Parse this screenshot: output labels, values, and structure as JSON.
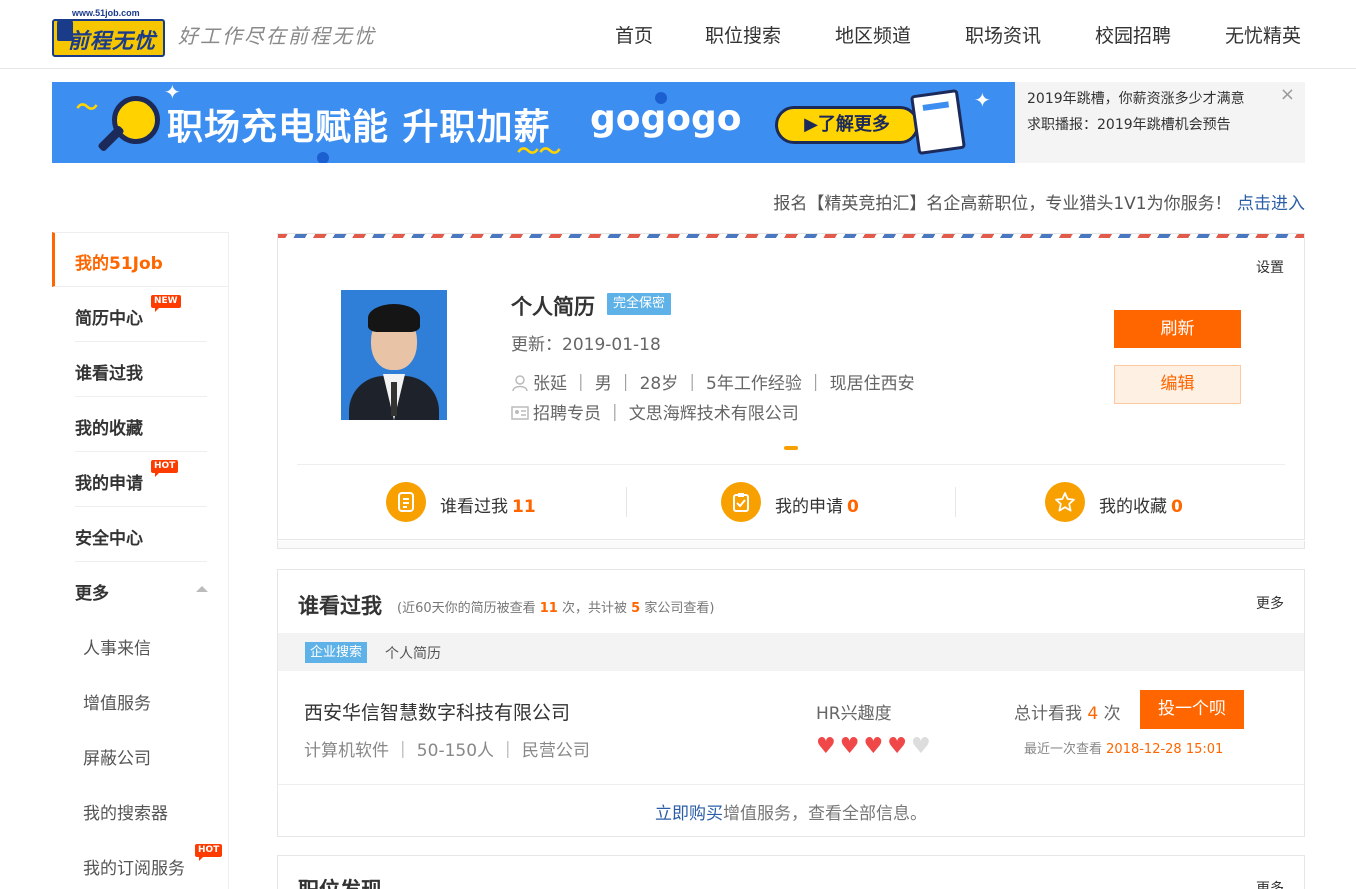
{
  "header": {
    "logo_url": "www.51job.com",
    "logo_text": "前程无忧",
    "slogan": "好工作尽在前程无忧",
    "nav": [
      "首页",
      "职位搜索",
      "地区频道",
      "职场资讯",
      "校园招聘",
      "无忧精英"
    ]
  },
  "banner": {
    "title": "职场充电赋能  升职加薪",
    "go": "gogogo",
    "button": "▶了解更多"
  },
  "side_news": {
    "items": [
      "2019年跳槽，你薪资涨多少才满意",
      "求职播报：2019年跳槽机会预告"
    ],
    "close": "×"
  },
  "promo": {
    "text": "报名【精英竞拍汇】名企高薪职位，专业猎头1V1为你服务！",
    "link": "点击进入"
  },
  "menu": {
    "active": "我的51Job",
    "items": [
      "简历中心",
      "谁看过我",
      "我的收藏",
      "我的申请",
      "安全中心",
      "更多"
    ],
    "badge_new": "NEW",
    "badge_hot": "HOT",
    "sub_items": [
      "人事来信",
      "增值服务",
      "屏蔽公司",
      "我的搜索器",
      "我的订阅服务"
    ]
  },
  "profile": {
    "settings": "设置",
    "title": "个人简历",
    "privacy": "完全保密",
    "updated": "更新：2019-01-18",
    "info_line": "张延 ｜ 男 ｜ 28岁 ｜ 5年工作经验 ｜ 现居住西安",
    "job_line": "招聘专员 ｜ 文思海辉技术有限公司",
    "refresh": "刷新",
    "edit": "编辑",
    "stats": [
      {
        "label": "谁看过我",
        "count": "11"
      },
      {
        "label": "我的申请",
        "count": "0"
      },
      {
        "label": "我的收藏",
        "count": "0"
      }
    ]
  },
  "viewed": {
    "title": "谁看过我",
    "sub_prefix": "(近60天你的简历被查看",
    "views": "11",
    "sub_mid": "次，共计被",
    "companies": "5",
    "sub_suffix": "家公司查看)",
    "more": "更多",
    "tab_active": "企业搜索",
    "tab": "个人简历",
    "company": "西安华信智慧数字科技有限公司",
    "company_info": "计算机软件 ｜ 50-150人 ｜ 民营公司",
    "hr_interest_label": "HR兴趣度",
    "hr_interest": 4,
    "hr_interest_max": 5,
    "total_prefix": "总计看我",
    "total_count": "4",
    "total_suffix": "次",
    "last_label": "最近一次查看",
    "last_time": "2018-12-28 15:01",
    "send_button": "投一个呗",
    "buy_link": "立即购买",
    "buy_text": "增值服务，查看全部信息。"
  },
  "next_section": {
    "title": "职位发现",
    "more": "更多"
  },
  "colors": {
    "accent": "#ff6600",
    "banner_bg": "#3d8ef1",
    "stat_icon": "#f7a000",
    "tag_blue": "#5fb2e8",
    "link": "#2b5ea8"
  }
}
